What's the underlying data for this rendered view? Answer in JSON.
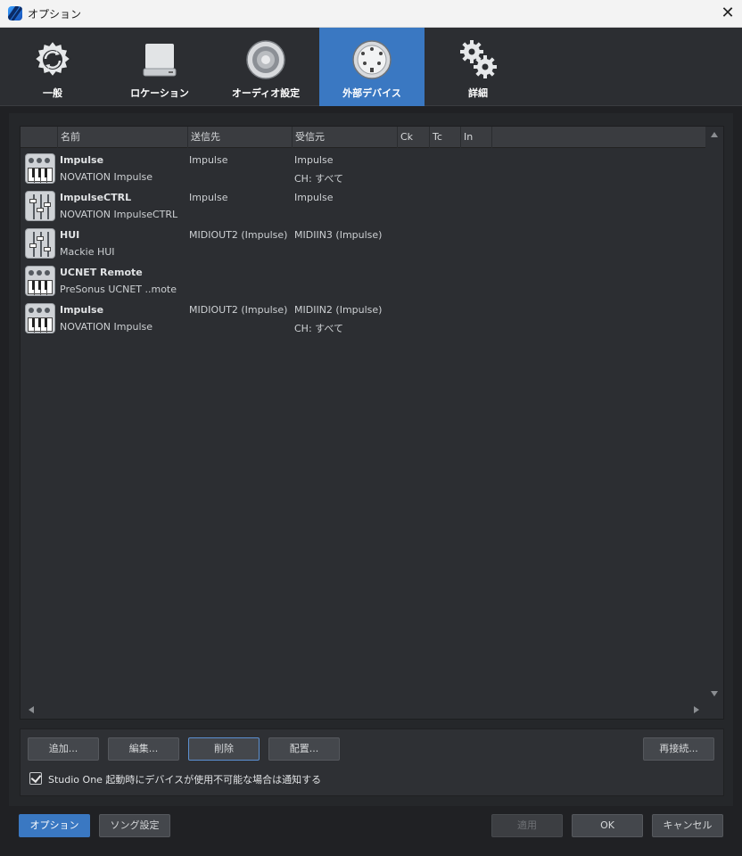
{
  "window": {
    "title": "オプション",
    "close": "✕"
  },
  "tabs": [
    {
      "label": "一般",
      "icon": "gear-sync-icon"
    },
    {
      "label": "ロケーション",
      "icon": "drive-icon"
    },
    {
      "label": "オーディオ設定",
      "icon": "speaker-icon"
    },
    {
      "label": "外部デバイス",
      "icon": "midi-port-icon",
      "active": true
    },
    {
      "label": "詳細",
      "icon": "gears-icon"
    }
  ],
  "list": {
    "columns": [
      "名前",
      "送信先",
      "受信元",
      "Ck",
      "Tc",
      "In"
    ],
    "rows": [
      {
        "icon": "keyboard-icon",
        "name": "Impulse",
        "model": "NOVATION Impulse",
        "send": "Impulse",
        "recv": "Impulse",
        "ch": "CH: すべて"
      },
      {
        "icon": "mixer-icon",
        "name": "ImpulseCTRL",
        "model": "NOVATION ImpulseCTRL",
        "send": "Impulse",
        "recv": "Impulse",
        "ch": ""
      },
      {
        "icon": "mixer-icon",
        "name": "HUI",
        "model": "Mackie HUI",
        "send": "MIDIOUT2 (Impulse)",
        "recv": "MIDIIN3 (Impulse)",
        "ch": ""
      },
      {
        "icon": "keyboard-icon",
        "name": "UCNET Remote",
        "model": "PreSonus UCNET ..mote",
        "send": "",
        "recv": "",
        "ch": ""
      },
      {
        "icon": "keyboard-icon",
        "name": "Impulse",
        "model": "NOVATION Impulse",
        "send": "MIDIOUT2 (Impulse)",
        "recv": "MIDIIN2 (Impulse)",
        "ch": "CH: すべて"
      }
    ]
  },
  "actions": {
    "add": "追加...",
    "edit": "編集...",
    "delete": "削除",
    "layout": "配置...",
    "reconnect": "再接続..."
  },
  "notify": {
    "checked": true,
    "label": "Studio One 起動時にデバイスが使用不可能な場合は通知する"
  },
  "footer": {
    "options": "オプション",
    "song_settings": "ソング設定",
    "apply": "適用",
    "ok": "OK",
    "cancel": "キャンセル"
  },
  "colors": {
    "accent": "#3a78c2",
    "background": "#202124",
    "panel": "#2c2e32"
  }
}
